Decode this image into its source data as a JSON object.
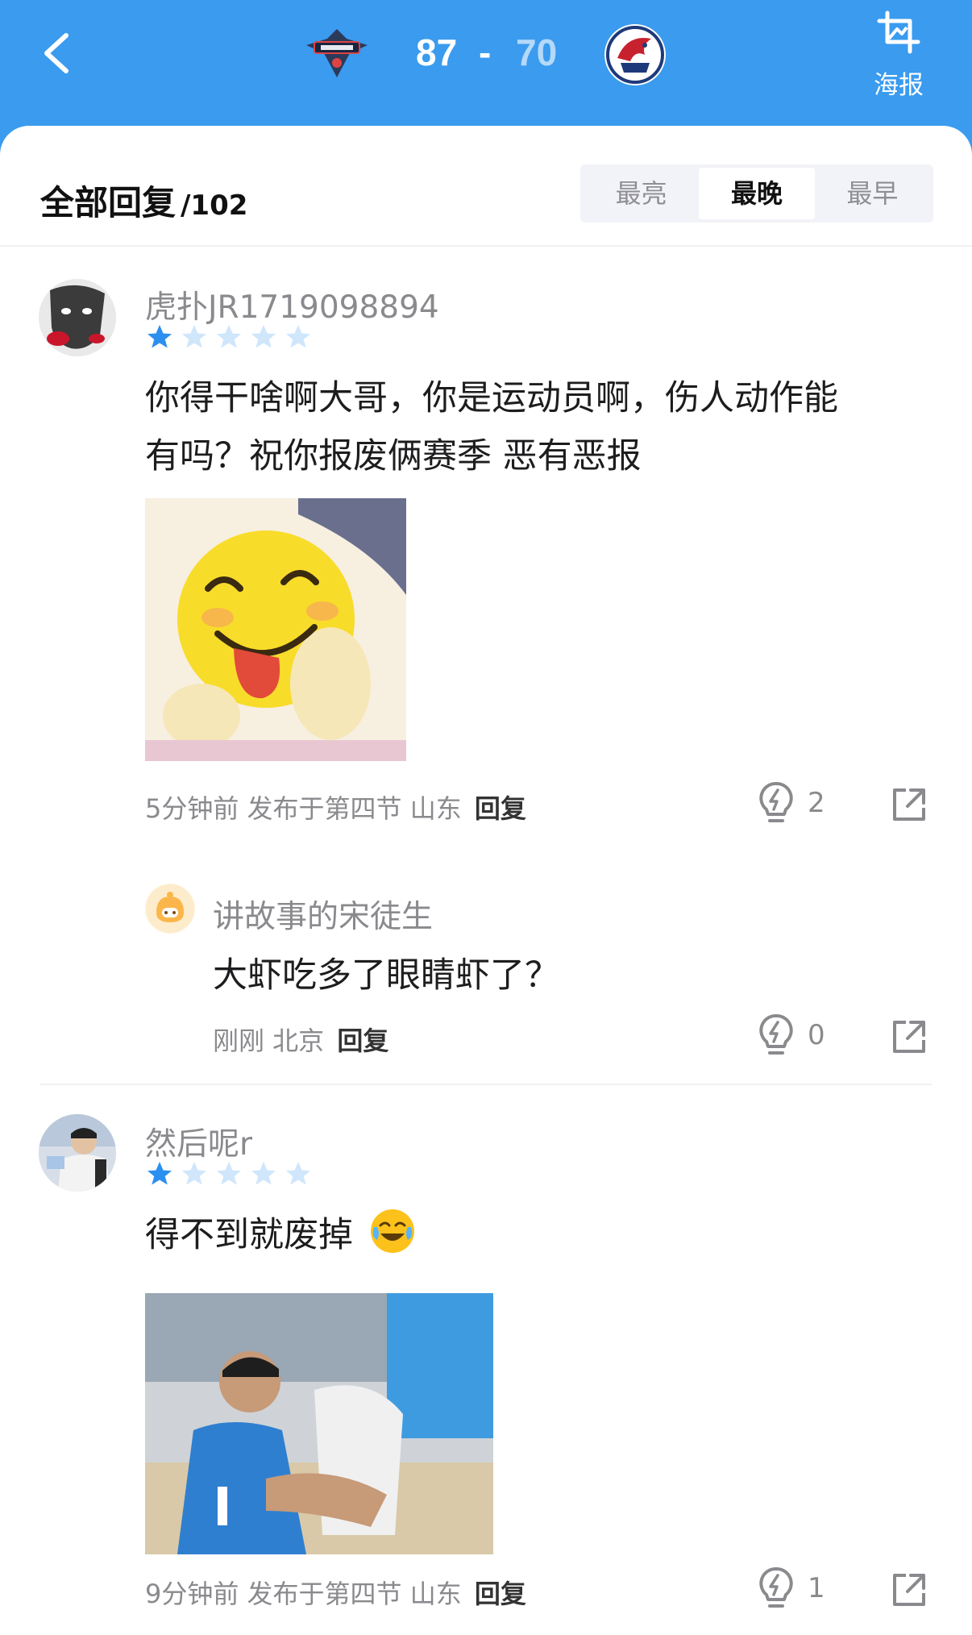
{
  "header": {
    "home_score": "87",
    "dash": "-",
    "away_score": "70",
    "poster_label": "海报"
  },
  "replies": {
    "title": "全部回复",
    "count": "/102",
    "tabs": [
      {
        "label": "最亮",
        "active": false
      },
      {
        "label": "最晚",
        "active": true
      },
      {
        "label": "最早",
        "active": false
      }
    ]
  },
  "comments": [
    {
      "username": "虎扑JR1719098894",
      "rating": 1,
      "text_line1": "你得干啥啊大哥，你是运动员啊，伤人动作能",
      "text_line2": "有吗？祝你报废俩赛季 恶有恶报",
      "meta": "5分钟前 发布于第四节 山东",
      "reply_label": "回复",
      "likes": "2"
    },
    {
      "username": "讲故事的宋徒生",
      "text": "大虾吃多了眼睛虾了？",
      "meta": "刚刚 北京",
      "reply_label": "回复",
      "likes": "0"
    },
    {
      "username": "然后呢r",
      "rating": 1,
      "text": "得不到就废掉",
      "meta": "9分钟前 发布于第四节 山东",
      "reply_label": "回复",
      "likes": "1"
    }
  ],
  "colors": {
    "header_bg": "#3a9bef",
    "star_filled": "#2b8ff0",
    "star_empty": "#cfe6fb"
  }
}
